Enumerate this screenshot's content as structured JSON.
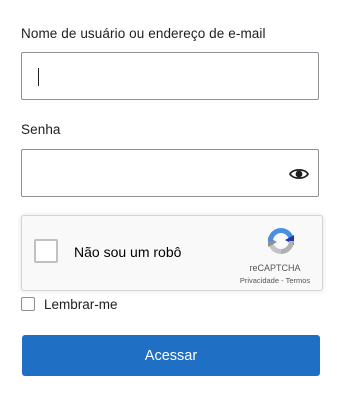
{
  "form": {
    "username_label": "Nome de usuário ou endereço de e-mail",
    "username_value": "",
    "password_label": "Senha",
    "password_value": "",
    "show_password_icon": "eye-icon",
    "recaptcha": {
      "label": "Não sou um robô",
      "brand": "reCAPTCHA",
      "privacy": "Privacidade",
      "separator": " - ",
      "terms": "Termos",
      "checked": false
    },
    "remember_label": "Lembrar-me",
    "remember_checked": false,
    "submit_label": "Acessar"
  },
  "colors": {
    "primary_button": "#1f6fc4",
    "input_border": "#8c8f94",
    "recaptcha_background": "#f9f9f9"
  }
}
